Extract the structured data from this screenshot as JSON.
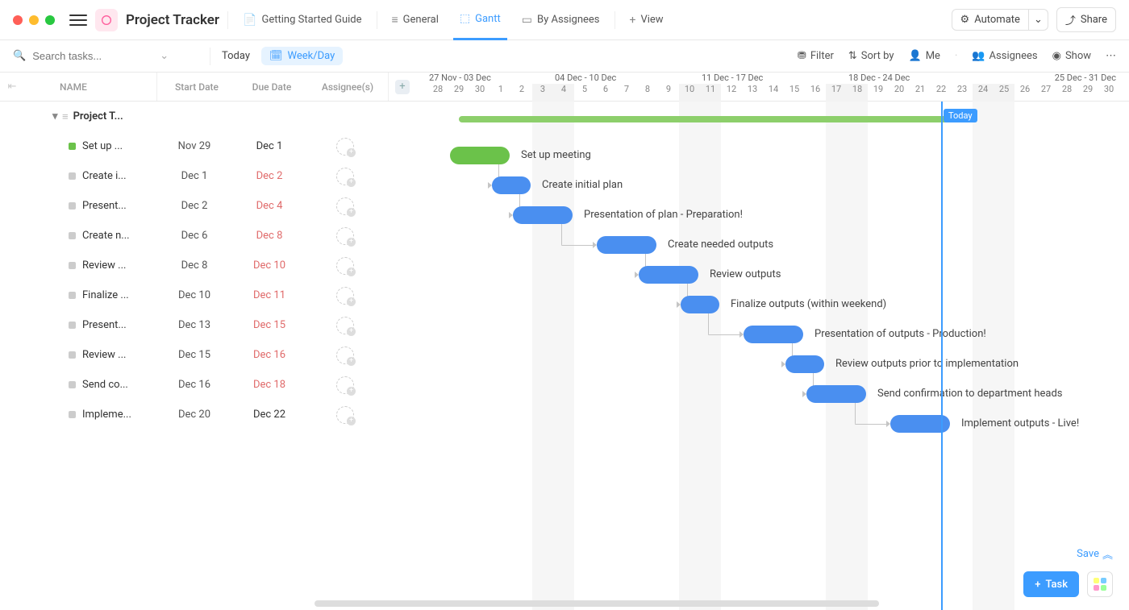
{
  "header": {
    "project_title": "Project Tracker",
    "tabs": [
      {
        "label": "Getting Started Guide"
      },
      {
        "label": "General"
      },
      {
        "label": "Gantt",
        "active": true
      },
      {
        "label": "By Assignees"
      }
    ],
    "view_label": "View",
    "automate_label": "Automate",
    "share_label": "Share"
  },
  "toolbar": {
    "search_placeholder": "Search tasks...",
    "today_label": "Today",
    "zoom_label": "Week/Day",
    "filter_label": "Filter",
    "sort_label": "Sort by",
    "me_label": "Me",
    "assignees_label": "Assignees",
    "show_label": "Show"
  },
  "columns": {
    "name": "NAME",
    "start": "Start Date",
    "due": "Due Date",
    "assignees": "Assignee(s)"
  },
  "group_name": "Project T...",
  "tasks": [
    {
      "name": "Set up meeting",
      "short": "Set up ...",
      "start": "Nov 29",
      "due": "Dec 1",
      "due_over": false,
      "done": true,
      "bar_start": 2,
      "bar_span": 3
    },
    {
      "name": "Create initial plan",
      "short": "Create i...",
      "start": "Dec 1",
      "due": "Dec 2",
      "due_over": true,
      "done": false,
      "bar_start": 4,
      "bar_span": 2
    },
    {
      "name": "Presentation of plan - Preparation!",
      "short": "Present...",
      "start": "Dec 2",
      "due": "Dec 4",
      "due_over": true,
      "done": false,
      "bar_start": 5,
      "bar_span": 3
    },
    {
      "name": "Create needed outputs",
      "short": "Create n...",
      "start": "Dec 6",
      "due": "Dec 8",
      "due_over": true,
      "done": false,
      "bar_start": 9,
      "bar_span": 3
    },
    {
      "name": "Review outputs",
      "short": "Review ...",
      "start": "Dec 8",
      "due": "Dec 10",
      "due_over": true,
      "done": false,
      "bar_start": 11,
      "bar_span": 3
    },
    {
      "name": "Finalize outputs (within weekend)",
      "short": "Finalize ...",
      "start": "Dec 10",
      "due": "Dec 11",
      "due_over": true,
      "done": false,
      "bar_start": 13,
      "bar_span": 2
    },
    {
      "name": "Presentation of outputs - Production!",
      "short": "Present...",
      "start": "Dec 13",
      "due": "Dec 15",
      "due_over": true,
      "done": false,
      "bar_start": 16,
      "bar_span": 3
    },
    {
      "name": "Review outputs prior to implementation",
      "short": "Review ...",
      "start": "Dec 15",
      "due": "Dec 16",
      "due_over": true,
      "done": false,
      "bar_start": 18,
      "bar_span": 2
    },
    {
      "name": "Send confirmation to department heads",
      "short": "Send co...",
      "start": "Dec 16",
      "due": "Dec 18",
      "due_over": true,
      "done": false,
      "bar_start": 19,
      "bar_span": 3
    },
    {
      "name": "Implement outputs - Live!",
      "short": "Impleme...",
      "start": "Dec 20",
      "due": "Dec 22",
      "due_over": false,
      "done": false,
      "bar_start": 23,
      "bar_span": 3
    }
  ],
  "timeline": {
    "weeks": [
      "27 Nov - 03 Dec",
      "04 Dec - 10 Dec",
      "11 Dec - 17 Dec",
      "18 Dec - 24 Dec",
      "25 Dec - 31 Dec"
    ],
    "days": [
      "28",
      "29",
      "30",
      "1",
      "2",
      "3",
      "4",
      "5",
      "6",
      "7",
      "8",
      "9",
      "10",
      "11",
      "12",
      "13",
      "14",
      "15",
      "16",
      "17",
      "18",
      "19",
      "20",
      "21",
      "22",
      "23",
      "24",
      "25",
      "26",
      "27",
      "28",
      "29",
      "30"
    ],
    "weekend_idx": [
      5,
      6,
      12,
      13,
      19,
      20,
      26,
      27
    ],
    "today_idx": 24,
    "today_label": "Today",
    "group_start": 2,
    "group_span": 24
  },
  "float": {
    "save_label": "Save",
    "task_label": "Task"
  },
  "colors": {
    "accent": "#3c9cff",
    "done": "#6bc24a",
    "bar": "#4a8ff0",
    "overdue": "#e06a6a"
  }
}
